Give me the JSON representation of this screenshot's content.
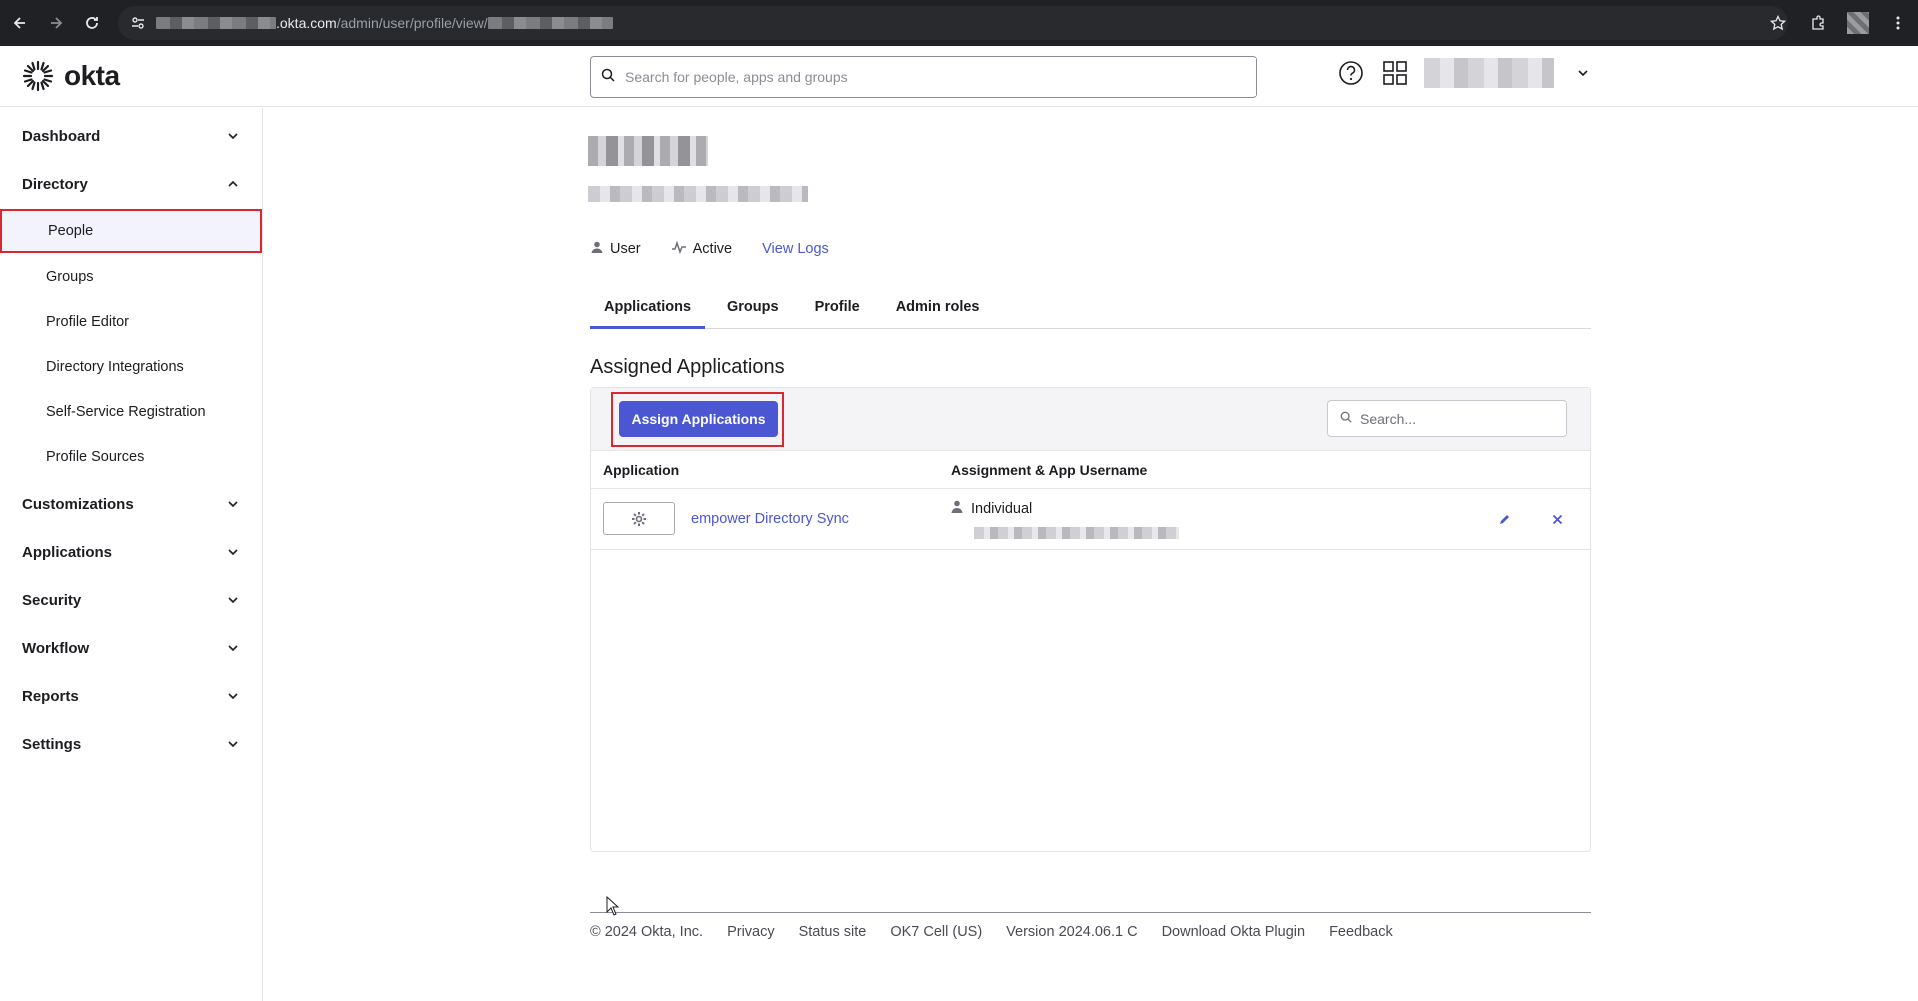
{
  "browser": {
    "url_host": ".okta.com",
    "url_path": "/admin/user/profile/view/"
  },
  "header": {
    "logo_text": "okta",
    "search_placeholder": "Search for people, apps and groups"
  },
  "sidebar": {
    "sections": [
      {
        "label": "Dashboard",
        "expanded": false
      },
      {
        "label": "Directory",
        "expanded": true
      },
      {
        "label": "Customizations",
        "expanded": false
      },
      {
        "label": "Applications",
        "expanded": false
      },
      {
        "label": "Security",
        "expanded": false
      },
      {
        "label": "Workflow",
        "expanded": false
      },
      {
        "label": "Reports",
        "expanded": false
      },
      {
        "label": "Settings",
        "expanded": false
      }
    ],
    "directory_items": [
      {
        "label": "People",
        "selected": true
      },
      {
        "label": "Groups"
      },
      {
        "label": "Profile Editor"
      },
      {
        "label": "Directory Integrations"
      },
      {
        "label": "Self-Service Registration"
      },
      {
        "label": "Profile Sources"
      }
    ]
  },
  "profile": {
    "type": "User",
    "status": "Active",
    "view_logs": "View Logs"
  },
  "tabs": [
    {
      "label": "Applications",
      "active": true
    },
    {
      "label": "Groups"
    },
    {
      "label": "Profile"
    },
    {
      "label": "Admin roles"
    }
  ],
  "assigned": {
    "title": "Assigned Applications",
    "assign_button": "Assign Applications",
    "search_placeholder": "Search...",
    "columns": [
      "Application",
      "Assignment & App Username"
    ],
    "rows": [
      {
        "app_name": "empower Directory Sync",
        "assignment": "Individual"
      }
    ]
  },
  "footer": {
    "items": [
      "© 2024 Okta, Inc.",
      "Privacy",
      "Status site",
      "OK7 Cell (US)",
      "Version 2024.06.1 C",
      "Download Okta Plugin",
      "Feedback"
    ]
  },
  "colors": {
    "accent": "#4b56d2",
    "highlight": "#d9282f"
  }
}
